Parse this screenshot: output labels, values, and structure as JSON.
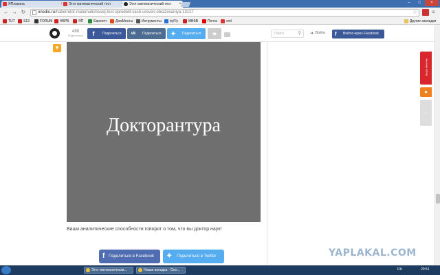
{
  "browser": {
    "tabs": [
      {
        "label": "ЯПлакалъ",
        "icon_color": "#d33"
      },
      {
        "label": "Этот математический тест",
        "icon_color": "#d33"
      },
      {
        "label": "Этот математический тест",
        "icon_color": "#222"
      }
    ],
    "close_glyph": "×",
    "window_controls": [
      "–",
      "□",
      "×"
    ],
    "url_host": "onedio.ru",
    "url_path": "/haber/etot-matematicheskij-test-opredelit-vash-uroven-obrazovaniya-13127",
    "bookmarks": [
      {
        "label": "TUT",
        "color": "#c22"
      },
      {
        "label": "S13",
        "color": "#c22"
      },
      {
        "label": "FORUM",
        "color": "#333"
      },
      {
        "label": "НВРБ",
        "color": "#c22"
      },
      {
        "label": "ЯП",
        "color": "#c22"
      },
      {
        "label": "Евроопт",
        "color": "#2a8a3a"
      },
      {
        "label": "ДомМенты",
        "color": "#e04a1a"
      },
      {
        "label": "Интрументы",
        "color": "#555"
      },
      {
        "label": "byFly",
        "color": "#2a6fd6"
      },
      {
        "label": "MBБВ",
        "color": "#c22"
      },
      {
        "label": "Почта",
        "color": "#d00"
      },
      {
        "label": "xml",
        "color": "#d33"
      }
    ],
    "other_bookmarks": "Другие закладки"
  },
  "header": {
    "share_count": "499",
    "share_count_label": "Поделились",
    "fb_label": "Поделиться",
    "vk_label": "Поделиться",
    "tw_label": "Поделиться",
    "search_placeholder": "Поиск",
    "login_label": "Войти",
    "fb_login_label": "Войти через Facebook"
  },
  "result": {
    "title": "Докторантура",
    "caption": "Ваши аналитические способности говорят о том, что вы доктор наук!"
  },
  "share_buttons": {
    "facebook": "Поделиться в Facebook",
    "twitter": "Поделиться в Twitter"
  },
  "side_tabs": {
    "feedback": "Ваше мнение"
  },
  "watermark": "YAPLAKAL.COM",
  "taskbar": {
    "tasks": [
      "Этот математически...",
      "Новая вкладка - Goo..."
    ],
    "lang": "RU",
    "time": "20:51"
  },
  "colors": {
    "facebook": "#3b5998",
    "vk": "#4c6c91",
    "twitter": "#55acee",
    "result_bg": "#6f6f6f"
  }
}
